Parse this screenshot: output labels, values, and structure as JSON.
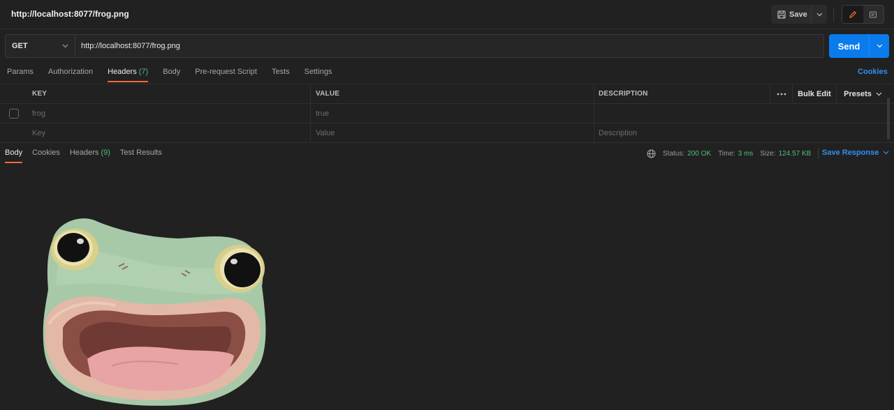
{
  "window": {
    "title": "http://localhost:8077/frog.png"
  },
  "toolbar": {
    "save_label": "Save"
  },
  "request": {
    "method": "GET",
    "url": "http://localhost:8077/frog.png",
    "send_label": "Send"
  },
  "request_tabs": [
    {
      "label": "Params"
    },
    {
      "label": "Authorization"
    },
    {
      "label": "Headers",
      "count": "(7)",
      "active": true
    },
    {
      "label": "Body"
    },
    {
      "label": "Pre-request Script"
    },
    {
      "label": "Tests"
    },
    {
      "label": "Settings"
    }
  ],
  "cookies_link": "Cookies",
  "headers_table": {
    "columns": [
      "KEY",
      "VALUE",
      "DESCRIPTION"
    ],
    "actions": {
      "bulk_edit": "Bulk Edit",
      "presets": "Presets"
    },
    "rows": [
      {
        "key": "frog",
        "value": "true",
        "description": ""
      }
    ],
    "placeholder": {
      "key": "Key",
      "value": "Value",
      "description": "Description"
    }
  },
  "response_tabs": [
    {
      "label": "Body",
      "active": true
    },
    {
      "label": "Cookies"
    },
    {
      "label": "Headers",
      "count": "(9)"
    },
    {
      "label": "Test Results"
    }
  ],
  "response_status": {
    "status_label": "Status:",
    "status_value": "200 OK",
    "time_label": "Time:",
    "time_value": "3 ms",
    "size_label": "Size:",
    "size_value": "124.57 KB"
  },
  "save_response_label": "Save Response",
  "colors": {
    "accent": "#097bed",
    "tab_underline": "#f26b3a",
    "success": "#4fbf7a",
    "link": "#2f90f2"
  }
}
